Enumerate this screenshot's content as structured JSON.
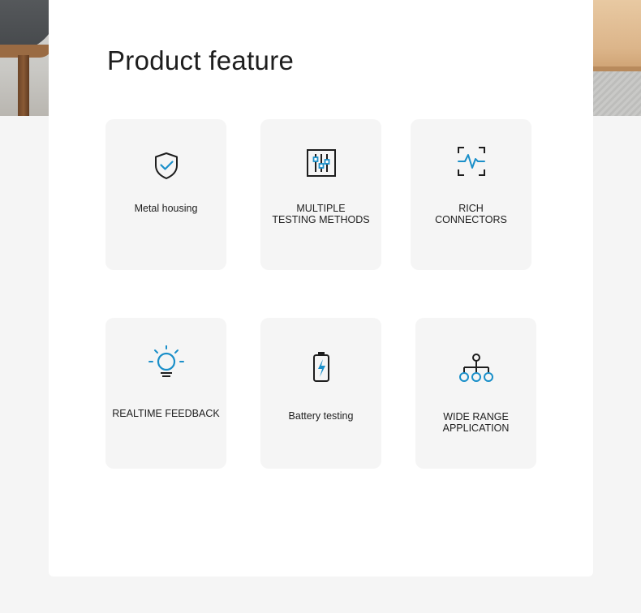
{
  "page": {
    "title": "Product feature"
  },
  "features": [
    {
      "label": "Metal housing",
      "icon": "shield-check-icon"
    },
    {
      "label": "MULTIPLE\nTESTING METHODS",
      "icon": "sliders-panel-icon"
    },
    {
      "label": "RICH\nCONNECTORS",
      "icon": "waveform-scan-icon"
    },
    {
      "label": "REALTIME FEEDBACK",
      "icon": "lightbulb-icon"
    },
    {
      "label": "Battery testing",
      "icon": "battery-charge-icon"
    },
    {
      "label": "WIDE RANGE\nAPPLICATION",
      "icon": "network-tree-icon"
    }
  ],
  "colors": {
    "accent": "#1a8fc9",
    "icon_dark": "#1e1e1e",
    "card_bg": "#f5f5f5",
    "panel_bg": "#ffffff",
    "page_bg": "#f5f5f5"
  }
}
